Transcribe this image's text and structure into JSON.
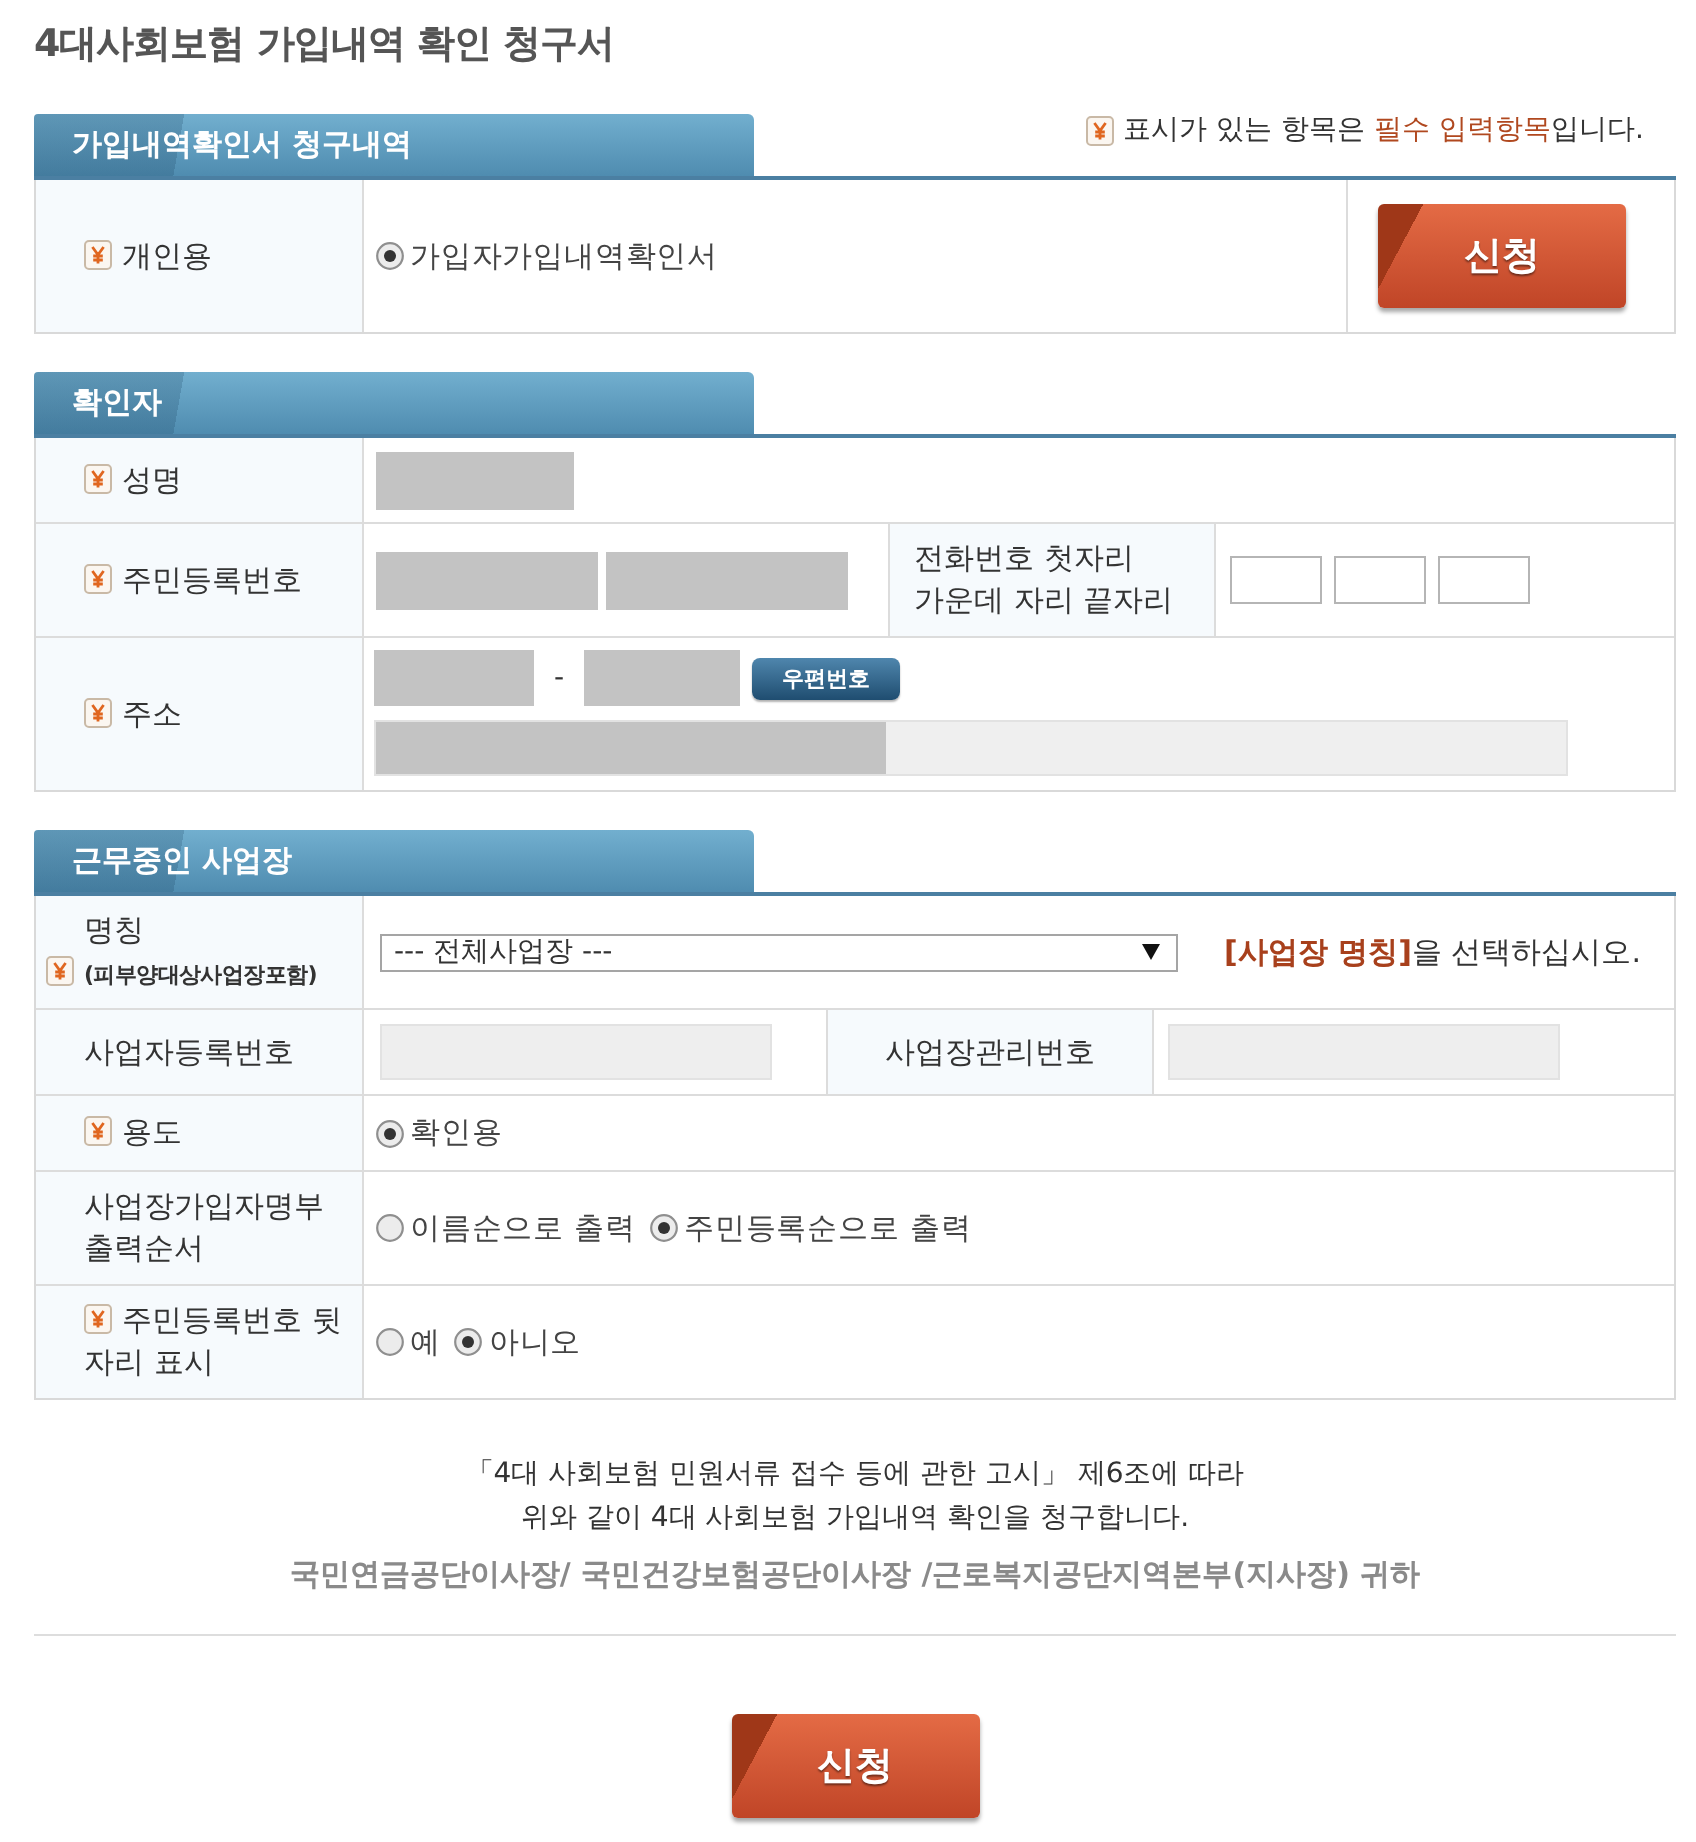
{
  "title": "4대사회보험 가입내역 확인 청구서",
  "required_note": {
    "before": "표시가 있는 항목은",
    "highlight": "필수 입력항목",
    "after": "입니다."
  },
  "sections": [
    {
      "heading": "가입내역확인서 청구내역",
      "rows": [
        {
          "kind": "radio",
          "label": "개인용",
          "required": true,
          "options": [
            {
              "label": "가입자가입내역확인서",
              "selected": true
            }
          ],
          "button": "신청"
        }
      ]
    },
    {
      "heading": "확인자",
      "rows": [
        {
          "kind": "masked",
          "label": "성명",
          "required": true
        },
        {
          "kind": "resident_phone",
          "label": "주민등록번호",
          "required": true,
          "side_label": "전화번호 첫자리 가운데 자리 끝자리"
        },
        {
          "kind": "address",
          "label": "주소",
          "required": true,
          "separator": "-",
          "button": "우편번호",
          "disabled": true
        }
      ]
    },
    {
      "heading": "근무중인 사업장",
      "rows": [
        {
          "kind": "select",
          "label": "명칭",
          "sublabel": "(피부양대상사업장포함)",
          "required": true,
          "value": "--- 전체사업장 ---",
          "hint": {
            "highlight": "[사업장 명칭]",
            "rest": "을 선택하십시오."
          }
        },
        {
          "kind": "number_pair",
          "label": "사업자등록번호",
          "required": false,
          "side_label": "사업장관리번호",
          "disabled": true
        },
        {
          "kind": "radio",
          "label": "용도",
          "required": true,
          "options": [
            {
              "label": "확인용",
              "selected": true
            }
          ]
        },
        {
          "kind": "radio",
          "label": "사업장가입자명부 출력순서",
          "required": false,
          "options": [
            {
              "label": "이름순으로 출력",
              "selected": false
            },
            {
              "label": "주민등록순으로 출력",
              "selected": true
            }
          ]
        },
        {
          "kind": "radio",
          "label": "주민등록번호 뒷자리 표시",
          "required": true,
          "options": [
            {
              "label": "예",
              "selected": false
            },
            {
              "label": "아니오",
              "selected": true
            }
          ]
        }
      ]
    }
  ],
  "notice_lines": [
    "「4대 사회보험 민원서류 접수 등에 관한 고시」 제6조에 따라",
    "위와 같이 4대 사회보험 가입내역 확인을 청구합니다."
  ],
  "addressee": "국민연금공단이사장/ 국민건강보험공단이사장 /근로복지공단지역본부(지사장) 귀하",
  "submit_button": "신청"
}
